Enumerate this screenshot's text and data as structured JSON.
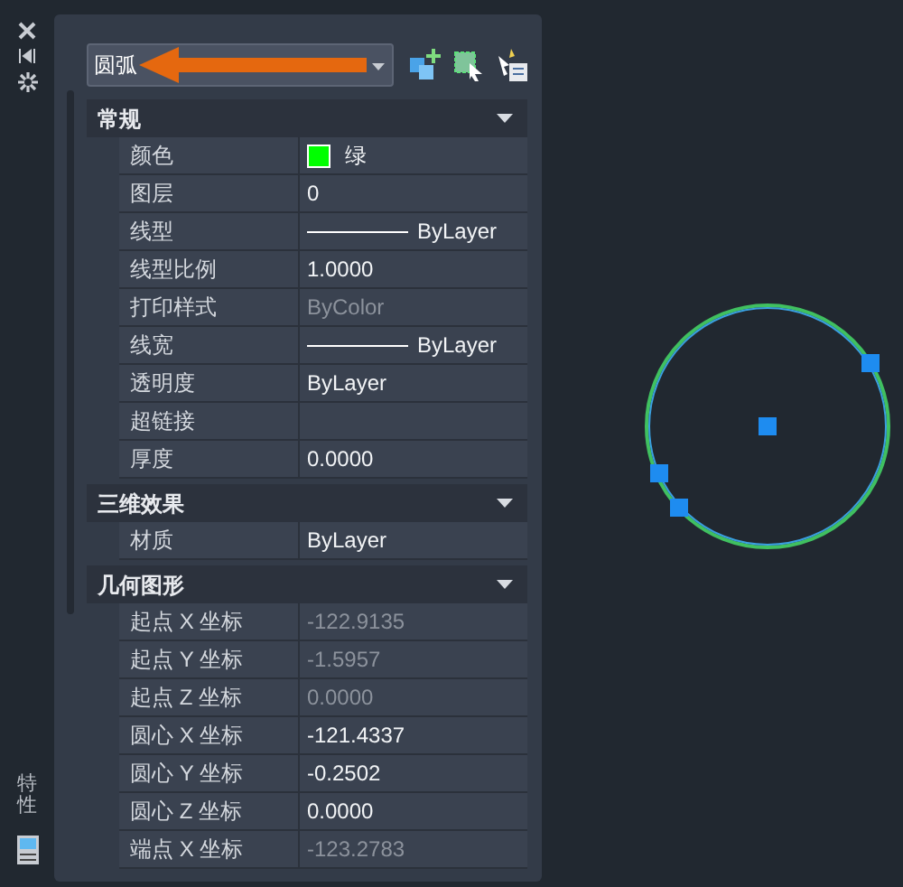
{
  "side_label": "特性",
  "object_select": {
    "value": "圆弧"
  },
  "sections": [
    {
      "title": "常规",
      "expanded": true,
      "rows": [
        {
          "label": "颜色",
          "value": "绿",
          "kind": "color",
          "color": "#00ff00",
          "disabled": false
        },
        {
          "label": "图层",
          "value": "0",
          "kind": "text",
          "disabled": false
        },
        {
          "label": "线型",
          "value": "ByLayer",
          "kind": "line",
          "disabled": false
        },
        {
          "label": "线型比例",
          "value": "1.0000",
          "kind": "text",
          "disabled": false
        },
        {
          "label": "打印样式",
          "value": "ByColor",
          "kind": "text",
          "disabled": true
        },
        {
          "label": "线宽",
          "value": "ByLayer",
          "kind": "line",
          "disabled": false
        },
        {
          "label": "透明度",
          "value": "ByLayer",
          "kind": "text",
          "disabled": false
        },
        {
          "label": "超链接",
          "kind": "empty"
        },
        {
          "label": "厚度",
          "value": "0.0000",
          "kind": "text",
          "disabled": false
        }
      ]
    },
    {
      "title": "三维效果",
      "expanded": true,
      "rows": [
        {
          "label": "材质",
          "value": "ByLayer",
          "kind": "text",
          "disabled": false
        }
      ]
    },
    {
      "title": "几何图形",
      "expanded": true,
      "rows": [
        {
          "label": "起点 X 坐标",
          "value": "-122.9135",
          "kind": "text",
          "disabled": true
        },
        {
          "label": "起点 Y 坐标",
          "value": "-1.5957",
          "kind": "text",
          "disabled": true
        },
        {
          "label": "起点 Z 坐标",
          "value": "0.0000",
          "kind": "text",
          "disabled": true
        },
        {
          "label": "圆心 X 坐标",
          "value": "-121.4337",
          "kind": "text",
          "disabled": false
        },
        {
          "label": "圆心 Y 坐标",
          "value": "-0.2502",
          "kind": "text",
          "disabled": false
        },
        {
          "label": "圆心 Z 坐标",
          "value": "0.0000",
          "kind": "text",
          "disabled": false
        },
        {
          "label": "端点 X 坐标",
          "value": "-123.2783",
          "kind": "text",
          "disabled": true
        }
      ]
    }
  ]
}
